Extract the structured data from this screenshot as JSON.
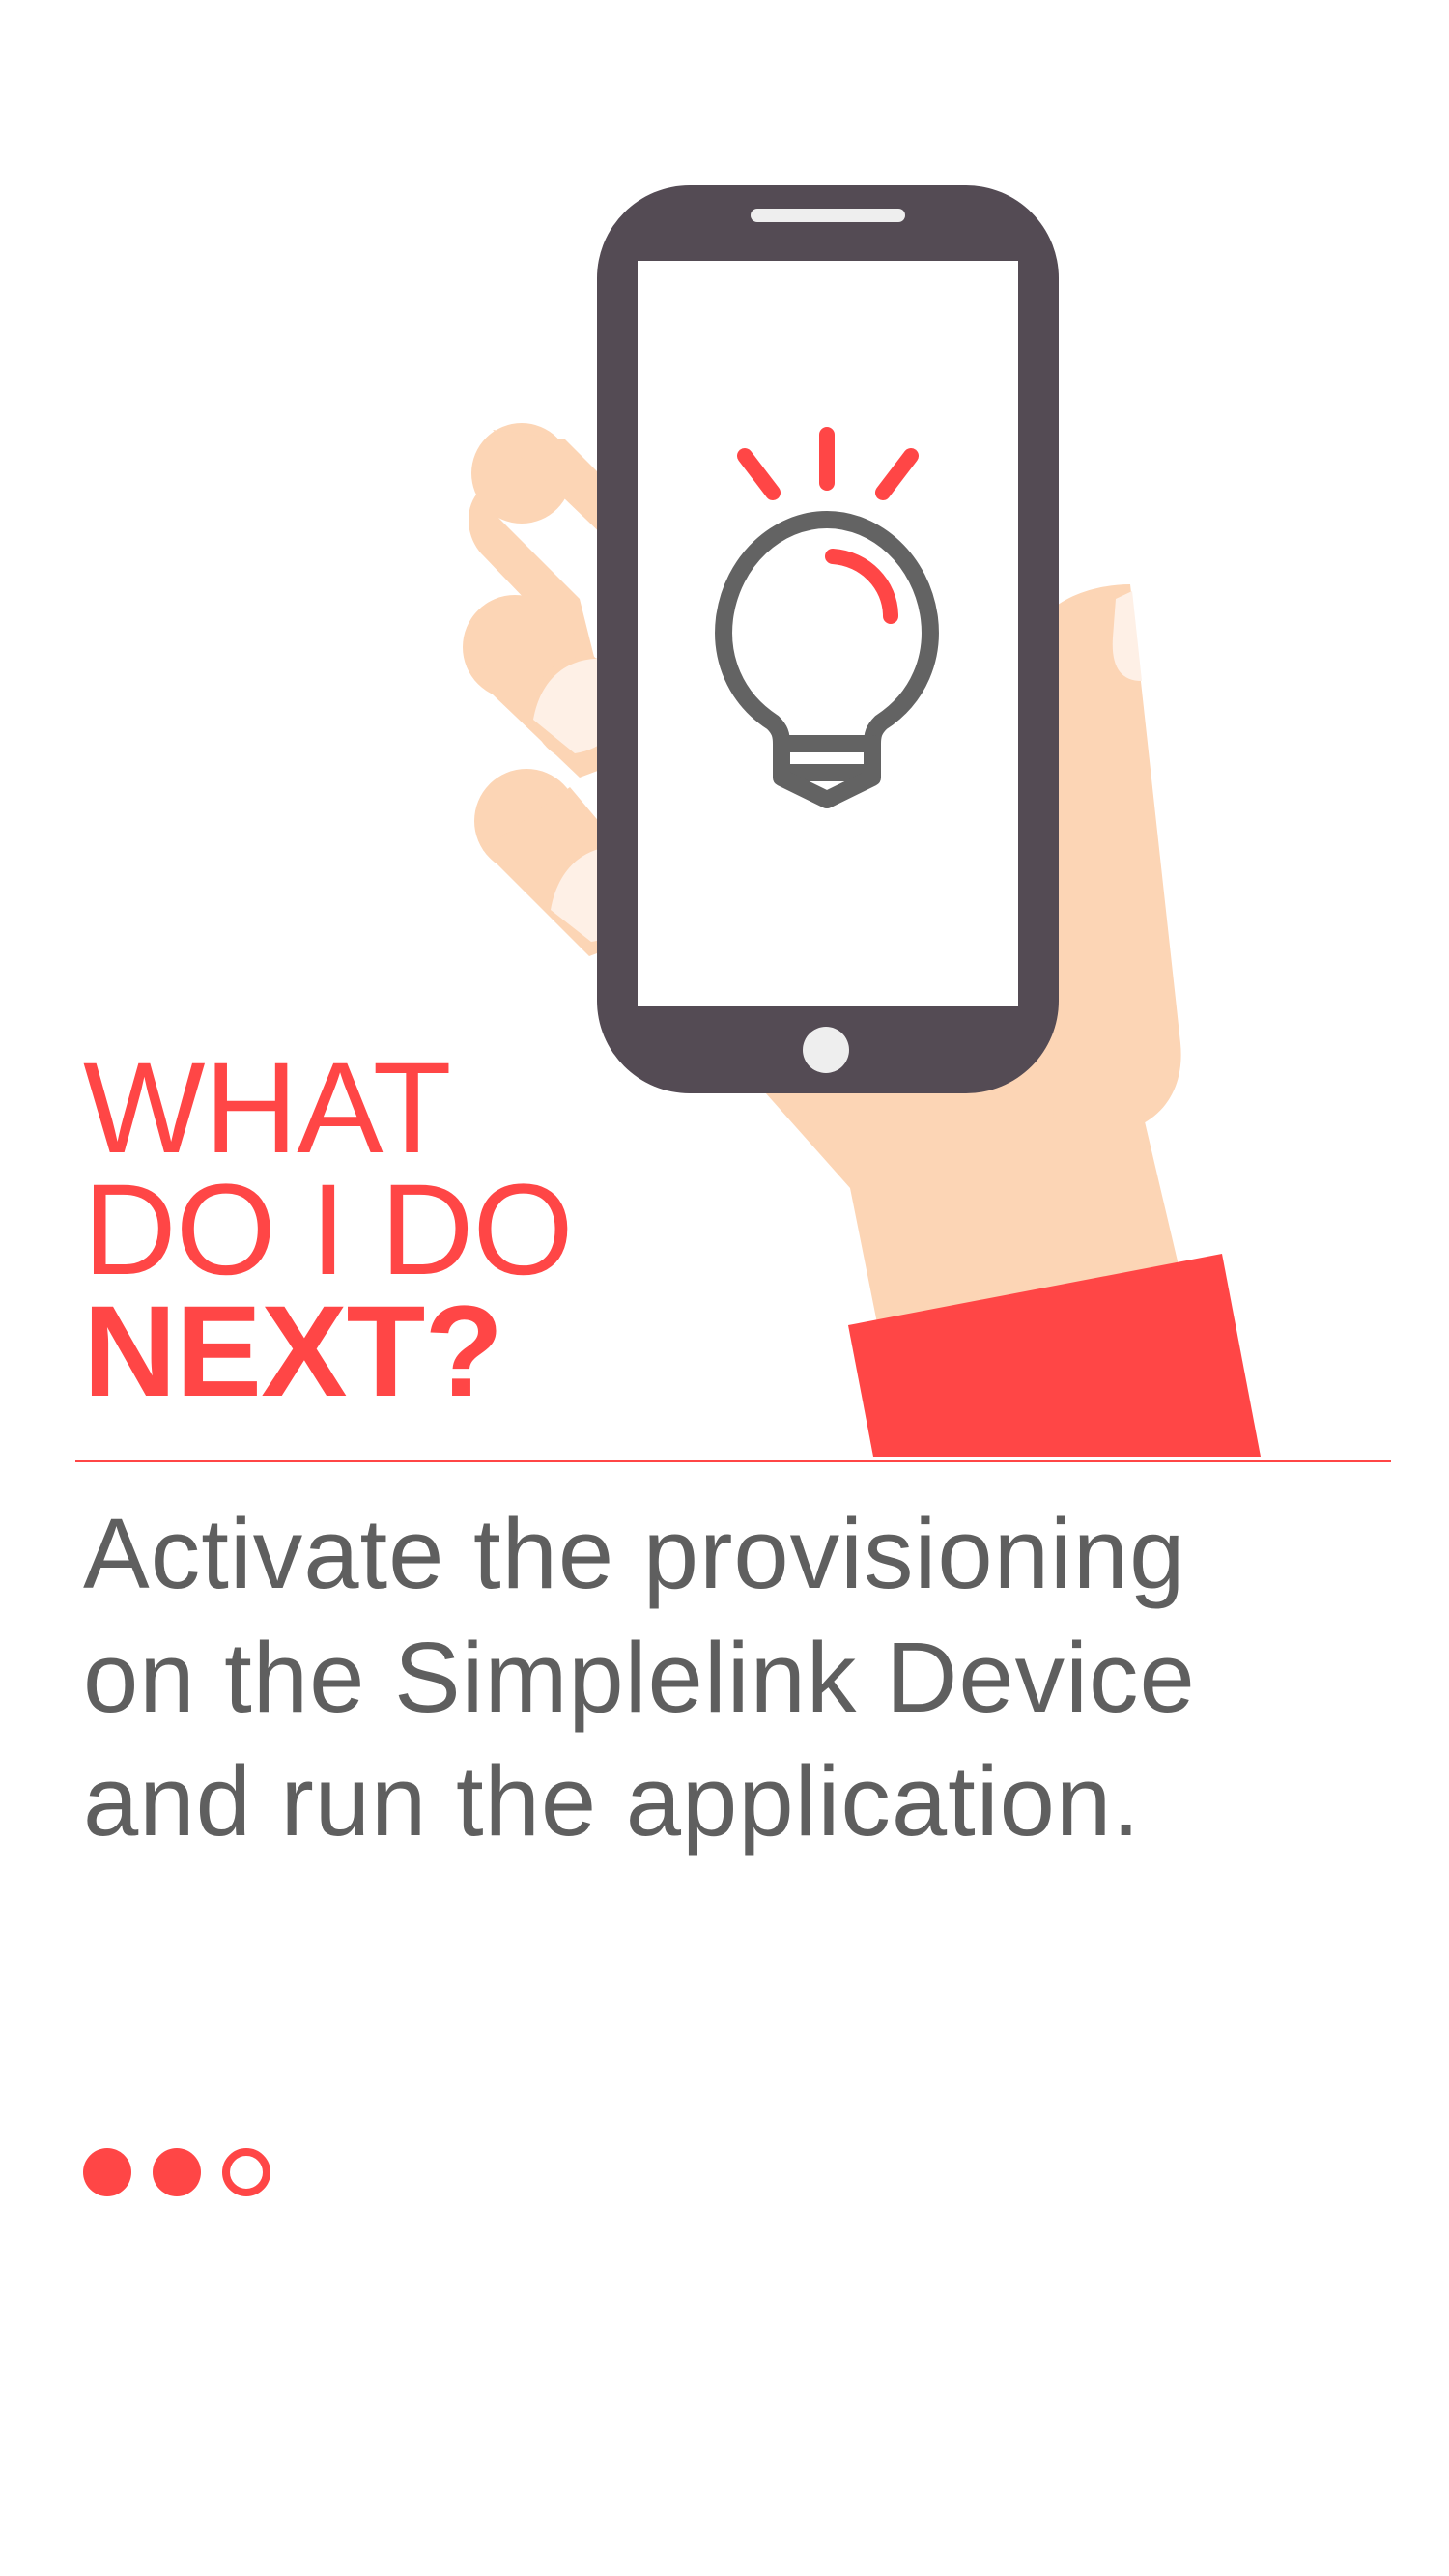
{
  "illustration": {
    "icon": "hand-holding-phone-lightbulb-icon",
    "colors": {
      "skin": "#fcd5b5",
      "nail": "#fef0e6",
      "phone": "#544b54",
      "screen": "#ffffff",
      "accent": "#ff4646",
      "bulb": "#636363"
    }
  },
  "headline": {
    "line1": "WHAT",
    "line2": "DO I DO",
    "line3": "NEXT?"
  },
  "body": {
    "line1": "Activate the provisioning",
    "line2": "on the Simplelink Device",
    "line3": "and run the application."
  },
  "pager": {
    "total": 3,
    "current": 3
  },
  "colors": {
    "accent": "#ff4646",
    "text": "#5f5f5f",
    "background": "#ffffff"
  }
}
